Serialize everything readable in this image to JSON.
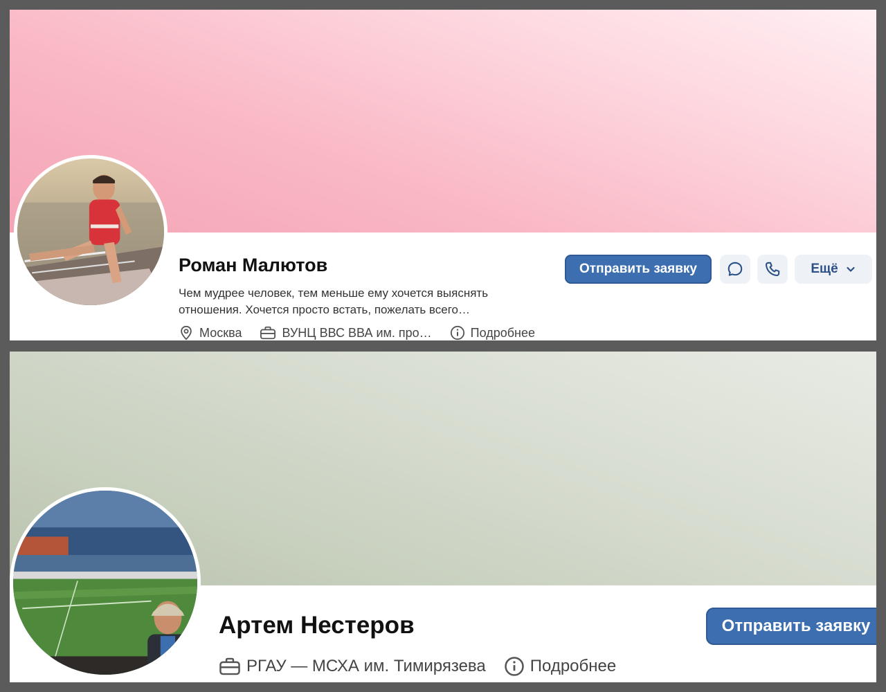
{
  "profiles": [
    {
      "name": "Роман Малютов",
      "status": "Чем мудрее человек, тем меньше ему хочется выяснять отношения. Хочется просто встать, пожелать всего…",
      "info": {
        "city": "Москва",
        "education": "ВУНЦ ВВС ВВА им. про…",
        "more": "Подробнее"
      },
      "actions": {
        "send_request": "Отправить заявку",
        "more": "Ещё"
      },
      "icons": [
        "location-icon",
        "briefcase-icon",
        "info-icon",
        "message-icon",
        "phone-icon",
        "chevron-down-icon"
      ],
      "cover_color": "#f6aabb"
    },
    {
      "name": "Артем Нестеров",
      "info": {
        "education": "РГАУ — МСХА им. Тимирязева",
        "more": "Подробнее"
      },
      "actions": {
        "send_request": "Отправить заявку"
      },
      "icons": [
        "briefcase-icon",
        "info-icon"
      ],
      "cover_color": "#c4ccb9"
    }
  ],
  "colors": {
    "primary_button": "#3d6eb0",
    "secondary_button": "#eef1f5",
    "secondary_text": "#2a5086"
  }
}
